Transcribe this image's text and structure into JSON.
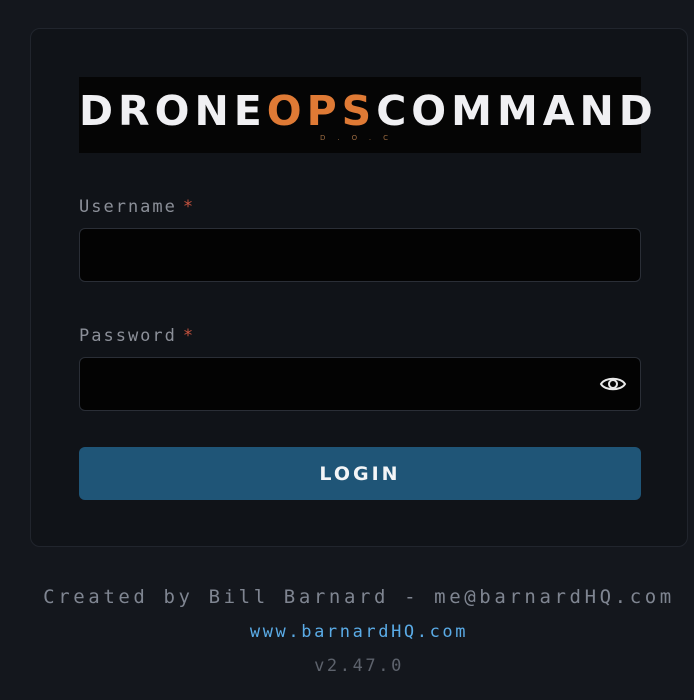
{
  "logo": {
    "part1": "DRONE",
    "part2": "OPS",
    "part3": "COMMAND",
    "subtitle": "D.O.C",
    "accent_color": "#df7a35"
  },
  "form": {
    "username_label": "Username",
    "password_label": "Password",
    "required_mark": "*",
    "username_value": "",
    "password_value": "",
    "show_password_icon": "eye-icon",
    "login_label": "LOGIN",
    "button_color": "#1f5577"
  },
  "footer": {
    "credit": "Created by Bill Barnard - me@barnardHQ.com",
    "website": "www.barnardHQ.com",
    "version": "v2.47.0",
    "link_color": "#5aabe6"
  }
}
